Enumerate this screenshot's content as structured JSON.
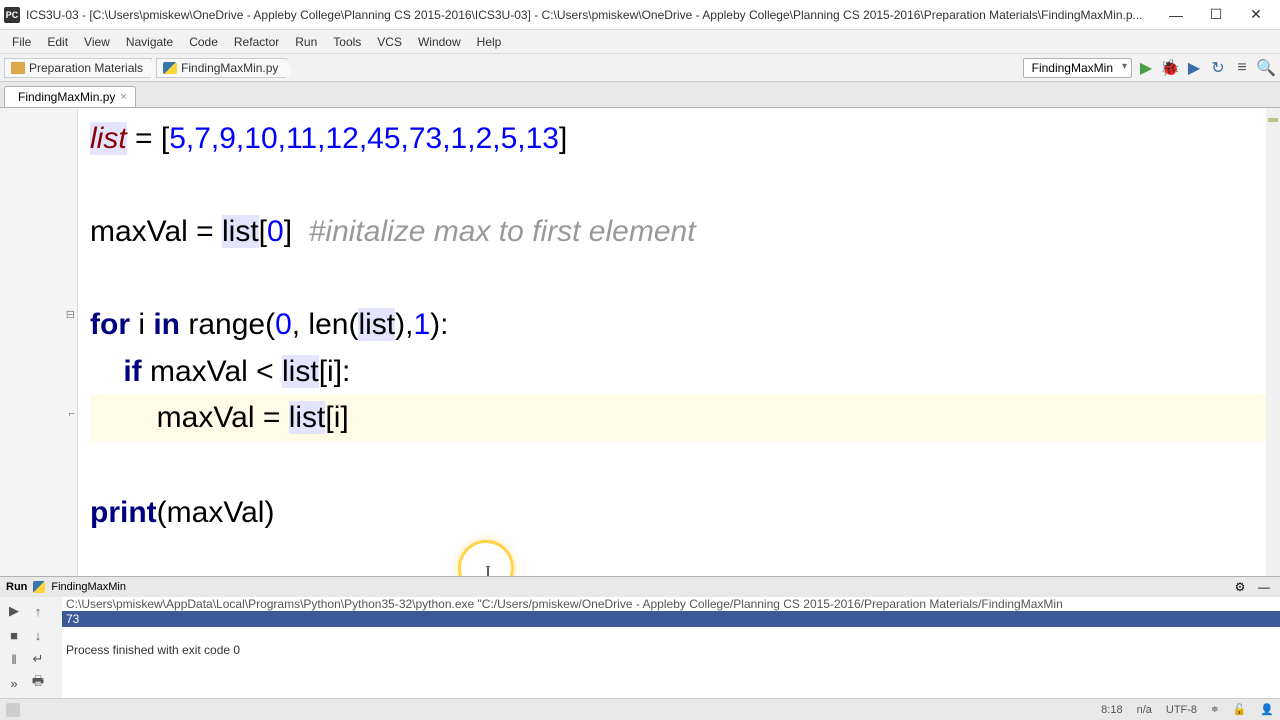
{
  "window": {
    "title": "ICS3U-03 - [C:\\Users\\pmiskew\\OneDrive - Appleby College\\Planning CS 2015-2016\\ICS3U-03] - C:\\Users\\pmiskew\\OneDrive - Appleby College\\Planning CS 2015-2016\\Preparation Materials\\FindingMaxMin.p...",
    "app_abbrev": "PC"
  },
  "menu": {
    "items": [
      "File",
      "Edit",
      "View",
      "Navigate",
      "Code",
      "Refactor",
      "Run",
      "Tools",
      "VCS",
      "Window",
      "Help"
    ]
  },
  "breadcrumb": {
    "items": [
      {
        "icon": "folder",
        "label": "Preparation Materials"
      },
      {
        "icon": "python",
        "label": "FindingMaxMin.py"
      }
    ]
  },
  "run_config": {
    "selected": "FindingMaxMin"
  },
  "tab": {
    "filename": "FindingMaxMin.py"
  },
  "code": {
    "line1": {
      "p1": "list",
      "p2": " = [",
      "nums": "5,7,9,10,11,12,45,73,1,2,5,13",
      "p3": "]"
    },
    "line3": {
      "p1": "maxVal = ",
      "p2": "list",
      "p3": "[",
      "idx": "0",
      "p4": "]  ",
      "comment": "#initalize max to first element"
    },
    "line5": {
      "kw_for": "for",
      "sp1": " i ",
      "kw_in": "in",
      "sp2": " range(",
      "arg0": "0",
      "comma1": ", len(",
      "listref": "list",
      "close1": "),",
      "arg1": "1",
      "close2": "):"
    },
    "line6": {
      "indent": "    ",
      "kw_if": "if",
      "cond": " maxVal < ",
      "listref": "list",
      "idx": "[i]:"
    },
    "line7": {
      "indent": "        maxVal = ",
      "listref": "list",
      "idx": "[i]"
    },
    "line9": {
      "pr": "print",
      "args": "(maxVal)"
    }
  },
  "run_panel": {
    "title": "Run",
    "config_name": "FindingMaxMin",
    "output_path": "C:\\Users\\pmiskew\\AppData\\Local\\Programs\\Python\\Python35-32\\python.exe \"C:/Users/pmiskew/OneDrive - Appleby College/Planning CS 2015-2016/Preparation Materials/FindingMaxMin",
    "result": "73",
    "exit_msg": "Process finished with exit code 0"
  },
  "status": {
    "pos": "8:18",
    "insert": "n/a",
    "encoding": "UTF-8",
    "lock": "🔓"
  }
}
